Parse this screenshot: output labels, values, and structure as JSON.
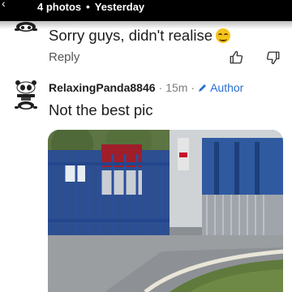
{
  "header": {
    "back_glyph": "‹",
    "photo_count": "4 photos",
    "separator": "•",
    "when": "Yesterday"
  },
  "comment1": {
    "text": "Sorry guys, didn't realise",
    "reply_label": "Reply"
  },
  "comment2": {
    "username": "RelaxingPanda8846",
    "separator": "·",
    "time": "15m",
    "author_tag": "Author",
    "text": "Not the best pic"
  },
  "icons": {
    "emoji": "grinning-face",
    "upvote": "thumb-up-outline",
    "downvote": "thumb-down-outline",
    "author": "pencil",
    "avatar": "panda"
  },
  "colors": {
    "author_blue": "#2a6ed3",
    "muted": "#7c7c7c",
    "header_bg": "#000000",
    "text": "#1c1c1c"
  }
}
